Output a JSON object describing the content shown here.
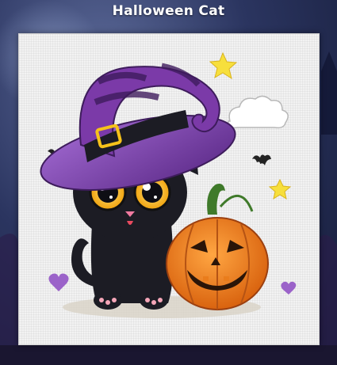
{
  "header": {
    "title": "Halloween Cat"
  },
  "artwork": {
    "subject": "cross-stitch-halloween-cat",
    "colors": {
      "hat_purple": "#7b3aa8",
      "hat_dark": "#3e1c5c",
      "cat_black": "#1c1c24",
      "eye_yellow": "#f6b51a",
      "pumpkin_orange": "#ea7d1c",
      "pumpkin_dark": "#9c4010",
      "stem_green": "#3f7a2a",
      "star_yellow": "#f7df3c",
      "heart_purple": "#9b63c9"
    }
  }
}
